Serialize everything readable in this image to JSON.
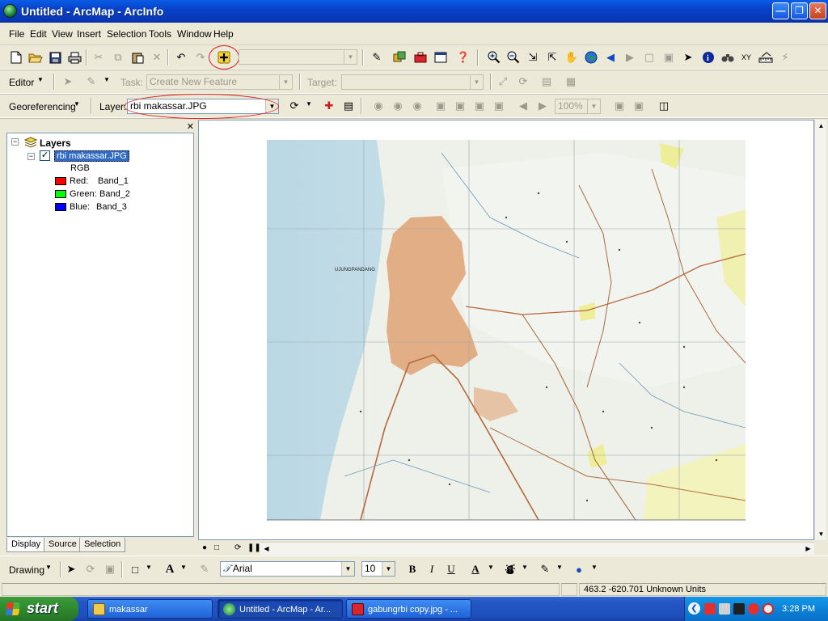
{
  "window": {
    "title": "Untitled - ArcMap - ArcInfo"
  },
  "menu": [
    "File",
    "Edit",
    "View",
    "Insert",
    "Selection",
    "Tools",
    "Window",
    "Help"
  ],
  "editor": {
    "editor_label": "Editor",
    "task_label": "Task:",
    "task_value": "Create New Feature",
    "target_label": "Target:",
    "target_value": ""
  },
  "georef": {
    "menu_label": "Georeferencing",
    "layer_label": "Layer:",
    "layer_value": "rbi makassar.JPG",
    "zoom_value": "100%"
  },
  "toc": {
    "root_label": "Layers",
    "layer_name": "rbi makassar.JPG",
    "layer_checked": true,
    "renderer": "RGB",
    "bands": [
      {
        "channel": "Red:",
        "band": "Band_1",
        "color": "#ff0000"
      },
      {
        "channel": "Green:",
        "band": "Band_2",
        "color": "#00ff00"
      },
      {
        "channel": "Blue:",
        "band": "Band_3",
        "color": "#0000ff"
      }
    ],
    "tabs": [
      "Display",
      "Source",
      "Selection"
    ],
    "active_tab": "Display"
  },
  "map_image": {
    "labels": [
      "UJUNGPANDANG"
    ]
  },
  "drawing": {
    "menu_label": "Drawing",
    "font_name": "Arial",
    "font_size": "10",
    "bold": "B",
    "italic": "I",
    "underline": "U",
    "font_color_label": "A"
  },
  "status": {
    "coordinates": "463.2  -620.701 Unknown Units"
  },
  "taskbar": {
    "start_label": "start",
    "tasks": [
      {
        "label": "makassar"
      },
      {
        "label": "Untitled - ArcMap - Ar..."
      },
      {
        "label": "gabungrbi copy.jpg - ..."
      }
    ],
    "clock": "3:28 PM"
  }
}
